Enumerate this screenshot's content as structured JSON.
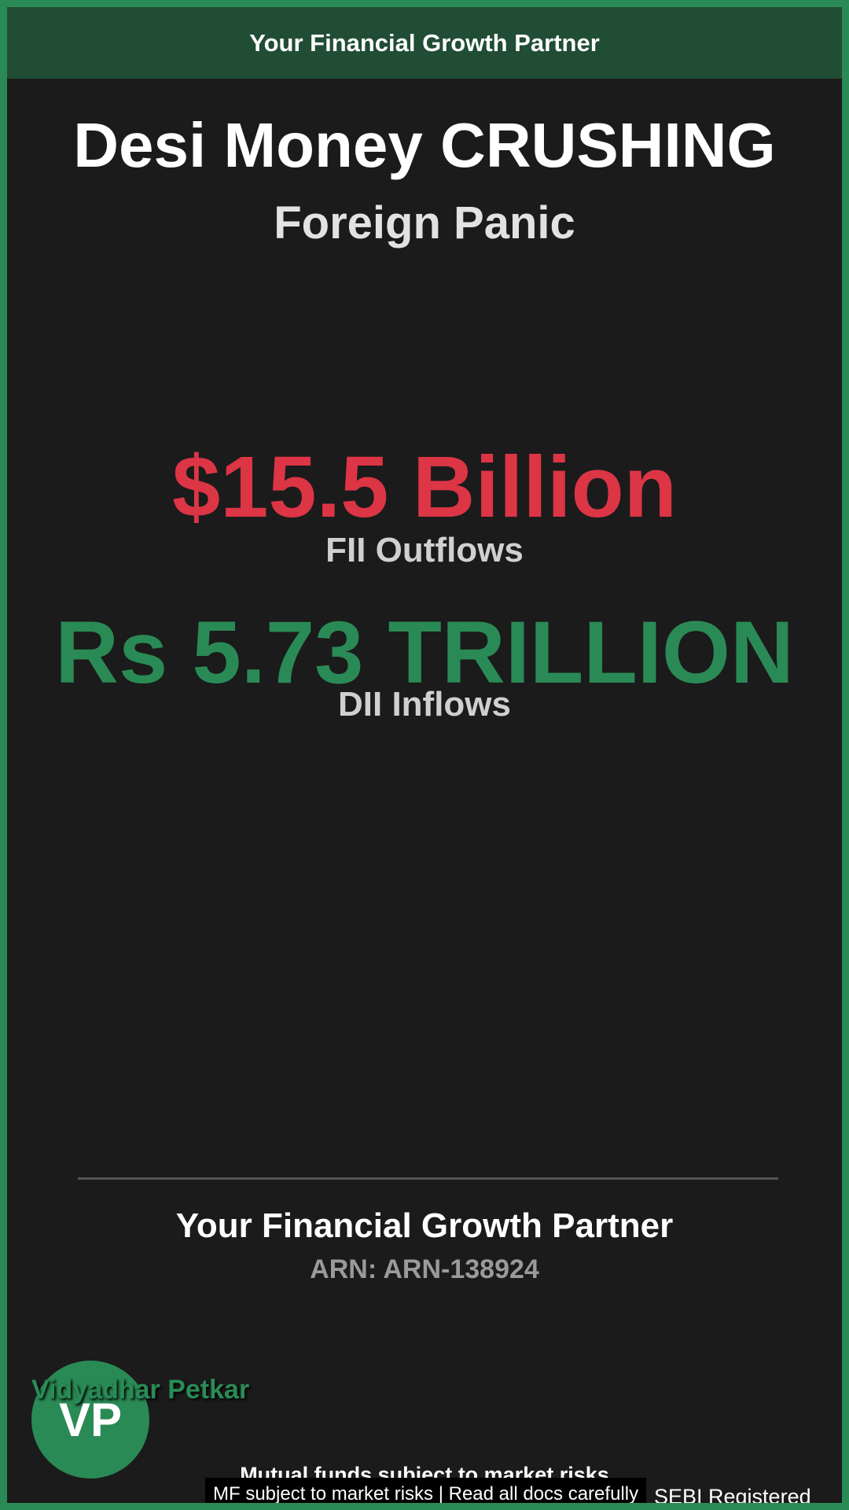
{
  "header": {
    "banner_text": "Your Financial Growth Partner"
  },
  "hero": {
    "headline": "Desi Money CRUSHING",
    "subheadline": "Foreign Panic"
  },
  "stats": {
    "fii": {
      "value": "$15.5 Billion",
      "label": "FII Outflows"
    },
    "dii": {
      "value": "Rs 5.73 TRILLION",
      "label": "DII Inflows"
    }
  },
  "footer": {
    "title": "Your Financial Growth Partner",
    "arn": "ARN: ARN-138924"
  },
  "advisor": {
    "name": "Vidyadhar Petkar",
    "initials": "VP"
  },
  "disclaimer": {
    "main": "Mutual funds subject to market risks",
    "box": "MF subject to market risks | Read all docs carefully",
    "registration": "SEBI Registered"
  },
  "colors": {
    "accent_green": "#2a8a55",
    "outflow_red": "#dc3545",
    "background": "#1b1b1b",
    "banner": "#214d35"
  }
}
